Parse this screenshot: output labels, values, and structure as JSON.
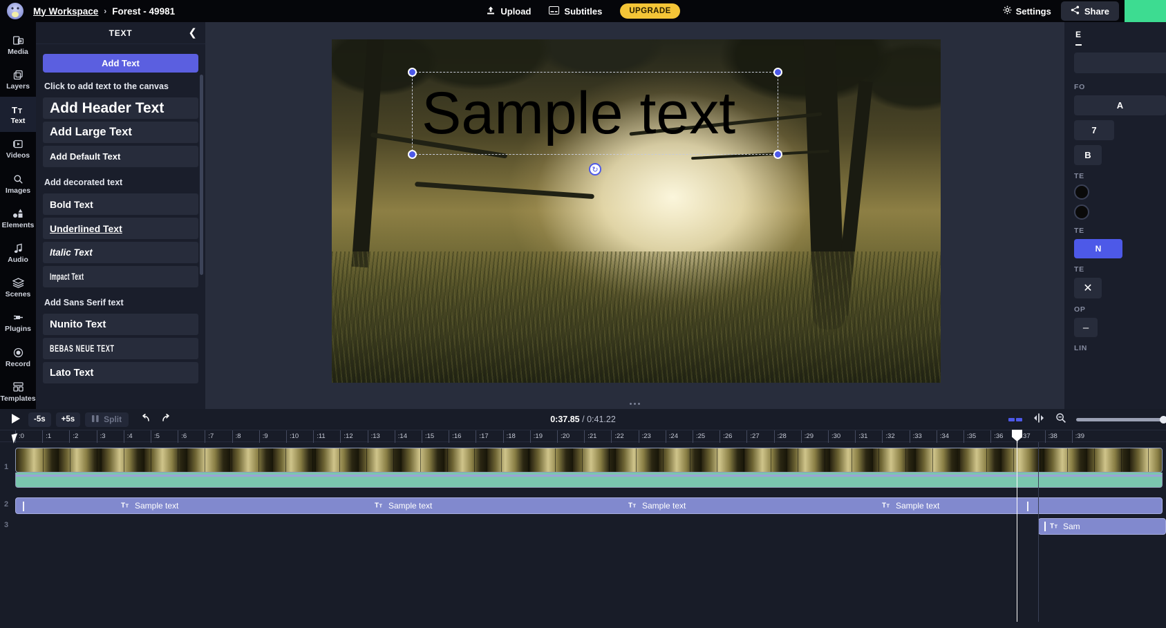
{
  "header": {
    "workspace": "My Workspace",
    "separator": "›",
    "project": "Forest - 49981",
    "upload_label": "Upload",
    "subtitles_label": "Subtitles",
    "upgrade_label": "UPGRADE",
    "settings_label": "Settings",
    "share_label": "Share"
  },
  "sidebar": {
    "items": [
      {
        "label": "Media",
        "icon": "media-add-icon",
        "active": false
      },
      {
        "label": "Layers",
        "icon": "layers-icon",
        "active": false
      },
      {
        "label": "Text",
        "icon": "text-icon",
        "active": true
      },
      {
        "label": "Videos",
        "icon": "video-icon",
        "active": false
      },
      {
        "label": "Images",
        "icon": "search-image-icon",
        "active": false
      },
      {
        "label": "Elements",
        "icon": "shapes-icon",
        "active": false
      },
      {
        "label": "Audio",
        "icon": "music-note-icon",
        "active": false
      },
      {
        "label": "Scenes",
        "icon": "stack-icon",
        "active": false
      },
      {
        "label": "Plugins",
        "icon": "plug-icon",
        "active": false
      },
      {
        "label": "Record",
        "icon": "record-circle-icon",
        "active": false
      },
      {
        "label": "Templates",
        "icon": "templates-icon",
        "active": false
      }
    ]
  },
  "panel": {
    "title": "TEXT",
    "collapse_icon": "chevron-left-icon",
    "add_text_button": "Add Text",
    "hint": "Click to add text to the canvas",
    "basic_items": [
      "Add Header Text",
      "Add Large Text",
      "Add Default Text"
    ],
    "decorated_label": "Add decorated text",
    "decorated_items": [
      "Bold Text",
      "Underlined Text",
      "Italic Text",
      "Impact Text"
    ],
    "sans_label": "Add Sans Serif text",
    "sans_items": [
      "Nunito Text",
      "BEBAS NEUE TEXT",
      "Lato Text"
    ]
  },
  "canvas": {
    "text": "Sample text",
    "text_color": "#000000",
    "selected": true,
    "rotate_icon": "rotate-handle-icon"
  },
  "properties": {
    "tab": "E",
    "font_label": "FO",
    "font_value": "A",
    "font_size": "7",
    "font_style": "B",
    "text_color_label": "TE",
    "text_align_label": "TE",
    "align_value": "N",
    "text_effect_label": "TE",
    "effect_icon": "no-effect-icon",
    "opacity_label": "OP",
    "opacity_minus": "–",
    "line_label": "LIN"
  },
  "timeline": {
    "play_icon": "play-icon",
    "back_5s": "-5s",
    "forward_5s": "+5s",
    "split_label": "Split",
    "undo_icon": "undo-icon",
    "redo_icon": "redo-icon",
    "current_time": "0:37.85",
    "time_divider": "/",
    "total_time": "0:41.22",
    "fit_icon": "fit-to-screen-icon",
    "align_icon": "split-view-icon",
    "zoom_out_icon": "zoom-out-icon",
    "zoom_level": 100,
    "ruler_ticks": [
      ":0",
      ":1",
      ":2",
      ":3",
      ":4",
      ":5",
      ":6",
      ":7",
      ":8",
      ":9",
      ":10",
      ":11",
      ":12",
      ":13",
      ":14",
      ":15",
      ":16",
      ":17",
      ":18",
      ":19",
      ":20",
      ":21",
      ":22",
      ":23",
      ":24",
      ":25",
      ":26",
      ":27",
      ":28",
      ":29",
      ":30",
      ":31",
      ":32",
      ":33",
      ":34",
      ":35",
      ":36",
      ":37",
      ":38",
      ":39"
    ],
    "playhead_time": ":37.85",
    "tracks": [
      {
        "number": "1",
        "type": "video",
        "label": ""
      },
      {
        "number": "2",
        "type": "text",
        "label": "Sample text"
      },
      {
        "number": "3",
        "type": "text",
        "label": "Sam"
      }
    ],
    "text_clip_labels": [
      "Sample text",
      "Sample text",
      "Sample text",
      "Sample text"
    ],
    "text_icon": "text-clip-icon",
    "track3_label": "Sam"
  },
  "colors": {
    "accent": "#5b5fe0",
    "upgrade": "#f4c537",
    "export": "#3ddc91",
    "text_clip": "#8189ce",
    "audio_clip": "#7ac6ae"
  }
}
